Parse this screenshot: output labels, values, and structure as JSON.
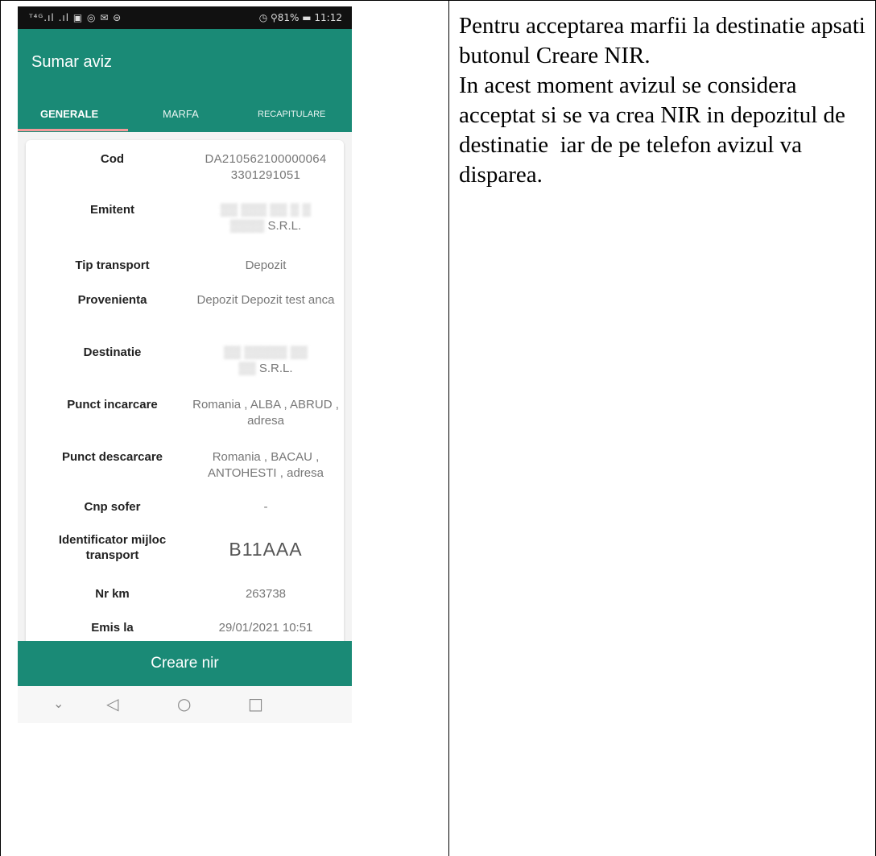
{
  "status_bar": {
    "left": "ᵀ⁴ᴳ.ıl .ıl ▣ ◎ ✉ ⊜",
    "right": "◷ ⚲81% ▬ 11:12"
  },
  "appbar": {
    "title": "Sumar aviz"
  },
  "tabs": [
    {
      "label": "GENERALE"
    },
    {
      "label": "MARFA"
    },
    {
      "label": "RECAPITULARE"
    }
  ],
  "details": [
    {
      "label": "Cod",
      "value": "DA210562100000064 3301291051"
    },
    {
      "label": "Emitent",
      "value": "S.R.L."
    },
    {
      "label": "Tip transport",
      "value": "Depozit"
    },
    {
      "label": "Provenienta",
      "value": "Depozit Depozit test anca"
    },
    {
      "label": "Destinatie",
      "value": "S.R.L."
    },
    {
      "label": "Punct incarcare",
      "value": "Romania , ALBA , ABRUD , adresa"
    },
    {
      "label": "Punct descarcare",
      "value": "Romania , BACAU , ANTOHESTI , adresa"
    },
    {
      "label": "Cnp sofer",
      "value": "-"
    },
    {
      "label": "Identificator mijloc transport",
      "value": "B11AAA"
    },
    {
      "label": "Nr km",
      "value": "263738"
    },
    {
      "label": "Emis la",
      "value": "29/01/2021 10:51"
    }
  ],
  "create_button": "Creare nir",
  "navbar": {
    "hide_icon": "chevron-down-icon",
    "back_icon": "back-triangle-icon",
    "home_icon": "home-circle-icon",
    "recents_icon": "recents-square-icon"
  },
  "instructions": {
    "p1": "Pentru acceptarea marfii la destinatie apsati butonul Creare NIR.",
    "p2": "In acest moment avizul se considera acceptat si se va crea NIR in depozitul de destinatie  iar de pe telefon avizul va disparea."
  },
  "colors": {
    "accent": "#1a8a76",
    "tab_indicator": "#f39a9a"
  }
}
